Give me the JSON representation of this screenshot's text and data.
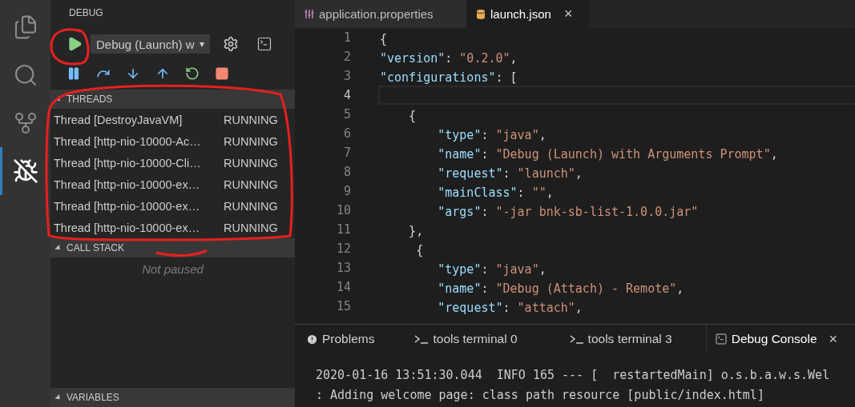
{
  "activity_bar": [
    {
      "kind": "files",
      "selected": false
    },
    {
      "kind": "search",
      "selected": false
    },
    {
      "kind": "source-control",
      "selected": false
    },
    {
      "kind": "debug",
      "selected": true
    }
  ],
  "sidebar": {
    "title": "DEBUG",
    "config_select": {
      "value": "Debug (Launch) w",
      "caret": "▾"
    },
    "controls": [
      {
        "kind": "pause"
      },
      {
        "kind": "step-over"
      },
      {
        "kind": "step-into"
      },
      {
        "kind": "step-out"
      },
      {
        "kind": "restart"
      },
      {
        "kind": "stop"
      }
    ],
    "sections": [
      {
        "kind": "threads",
        "title": "THREADS",
        "expanded": true,
        "rows": [
          {
            "name": "Thread [DestroyJavaVM]",
            "status": "RUNNING"
          },
          {
            "name": "Thread [http-nio-10000-Ac…",
            "status": "RUNNING"
          },
          {
            "name": "Thread [http-nio-10000-Cli…",
            "status": "RUNNING"
          },
          {
            "name": "Thread [http-nio-10000-ex…",
            "status": "RUNNING"
          },
          {
            "name": "Thread [http-nio-10000-ex…",
            "status": "RUNNING"
          },
          {
            "name": "Thread [http-nio-10000-ex…",
            "status": "RUNNING"
          }
        ]
      },
      {
        "kind": "callstack",
        "title": "CALL STACK",
        "expanded": true,
        "message": "Not paused"
      },
      {
        "kind": "variables",
        "title": "VARIABLES",
        "expanded": true
      }
    ]
  },
  "editor": {
    "tabs": [
      {
        "label": "application.properties",
        "kind": "properties",
        "selected": false
      },
      {
        "label": "launch.json",
        "kind": "json",
        "selected": true,
        "close": "×"
      }
    ],
    "lines": [
      {
        "number": "1",
        "text": "{",
        "current": false
      },
      {
        "number": "2",
        "text": "\"version\": \"0.2.0\",",
        "current": false
      },
      {
        "number": "3",
        "text": "\"configurations\": [",
        "current": false
      },
      {
        "number": "4",
        "current": true
      },
      {
        "number": "5",
        "text": "    {",
        "current": false
      },
      {
        "number": "6",
        "text": "        \"type\": \"java\",",
        "current": false
      },
      {
        "number": "7",
        "text": "        \"name\": \"Debug (Launch) with Arguments Prompt\",",
        "current": false
      },
      {
        "number": "8",
        "text": "        \"request\": \"launch\",",
        "current": false
      },
      {
        "number": "9",
        "text": "        \"mainClass\": \"\",",
        "current": false
      },
      {
        "number": "10",
        "text": "        \"args\": \"-jar bnk-sb-list-1.0.0.jar\"",
        "current": false
      },
      {
        "number": "11",
        "text": "    },",
        "current": false
      },
      {
        "number": "12",
        "text": "     {",
        "current": false
      },
      {
        "number": "13",
        "text": "        \"type\": \"java\",",
        "current": false
      },
      {
        "number": "14",
        "text": "        \"name\": \"Debug (Attach) - Remote\",",
        "current": false
      },
      {
        "number": "15",
        "text": "        \"request\": \"attach\",",
        "current": false
      }
    ]
  },
  "panel": {
    "tabs": [
      {
        "label": "Problems",
        "kind": "problems",
        "selected": false
      },
      {
        "label": "tools terminal 0",
        "kind": "terminal",
        "selected": false
      },
      {
        "label": "tools terminal 3",
        "kind": "terminal",
        "selected": false
      },
      {
        "label": "Debug Console",
        "kind": "console",
        "selected": true,
        "close": "×"
      }
    ],
    "lines": [
      "2020-01-16 13:51:30.044  INFO 165 --- [  restartedMain] o.s.b.a.w.s.Wel",
      ": Adding welcome page: class path resource [public/index.html]"
    ]
  }
}
